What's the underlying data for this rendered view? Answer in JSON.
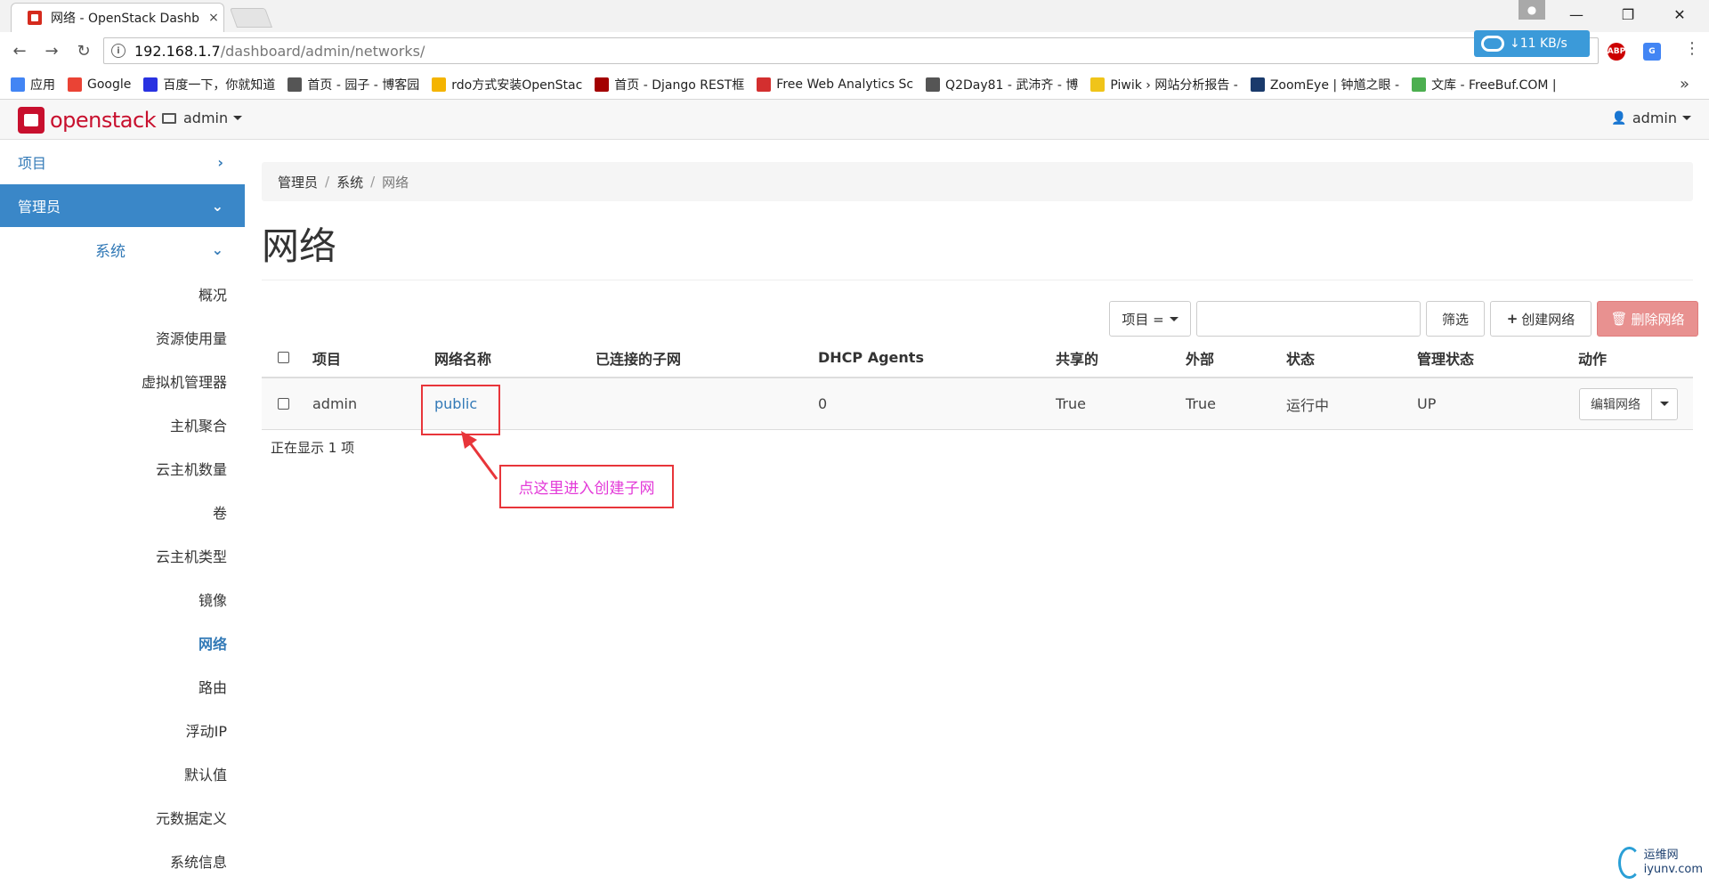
{
  "browser": {
    "tab_title": "网络 - OpenStack Dashb",
    "tab_close": "×",
    "window_controls": {
      "minimize": "—",
      "restore": "❐",
      "close": "✕"
    },
    "url_host": "192.168.1.7",
    "url_path": "/dashboard/admin/networks/",
    "download_speed": "↓11 KB/s",
    "ext_abp": "ABP",
    "ext_translate": "G",
    "bookmarks": [
      {
        "label": "应用",
        "color": "#4285f4"
      },
      {
        "label": "Google",
        "color": "#ea4335"
      },
      {
        "label": "百度一下，你就知道",
        "color": "#2932e1"
      },
      {
        "label": "首页 - 园子 - 博客园",
        "color": "#555555"
      },
      {
        "label": "rdo方式安装OpenStac",
        "color": "#f4b400"
      },
      {
        "label": "首页 - Django REST框",
        "color": "#a30000"
      },
      {
        "label": "Free Web Analytics Sc",
        "color": "#d32f2f"
      },
      {
        "label": "Q2Day81 - 武沛齐 - 博",
        "color": "#555555"
      },
      {
        "label": "Piwik › 网站分析报告 -",
        "color": "#f0c419"
      },
      {
        "label": "ZoomEye | 钟馗之眼 -",
        "color": "#1a3a6b"
      },
      {
        "label": "文库 - FreeBuf.COM |",
        "color": "#4caf50"
      }
    ],
    "bookmarks_more": "»"
  },
  "header": {
    "logo_text": "openstack",
    "project": "admin",
    "user": "admin"
  },
  "sidebar": {
    "project_label": "项目",
    "admin_label": "管理员",
    "system_label": "系统",
    "items": [
      {
        "label": "概况"
      },
      {
        "label": "资源使用量"
      },
      {
        "label": "虚拟机管理器"
      },
      {
        "label": "主机聚合"
      },
      {
        "label": "云主机数量"
      },
      {
        "label": "卷"
      },
      {
        "label": "云主机类型"
      },
      {
        "label": "镜像"
      },
      {
        "label": "网络"
      },
      {
        "label": "路由"
      },
      {
        "label": "浮动IP"
      },
      {
        "label": "默认值"
      },
      {
        "label": "元数据定义"
      },
      {
        "label": "系统信息"
      }
    ]
  },
  "main": {
    "breadcrumb": [
      "管理员",
      "系统",
      "网络"
    ],
    "breadcrumb_sep": "/",
    "title": "网络",
    "filter_select": "项目 =",
    "filter_button": "筛选",
    "create_button": "创建网络",
    "delete_button": "删除网络",
    "columns": [
      "项目",
      "网络名称",
      "已连接的子网",
      "DHCP Agents",
      "共享的",
      "外部",
      "状态",
      "管理状态",
      "动作"
    ],
    "rows": [
      {
        "project": "admin",
        "name": "public",
        "subnets": "",
        "dhcp_agents": "0",
        "shared": "True",
        "external": "True",
        "status": "运行中",
        "admin_state": "UP",
        "action": "编辑网络"
      }
    ],
    "count_text": "正在显示 1 项"
  },
  "annotation": {
    "callout_text": "点这里进入创建子网",
    "color": "#e8353a"
  },
  "watermark": {
    "line1": "运维网",
    "line2": "iyunv.com"
  }
}
